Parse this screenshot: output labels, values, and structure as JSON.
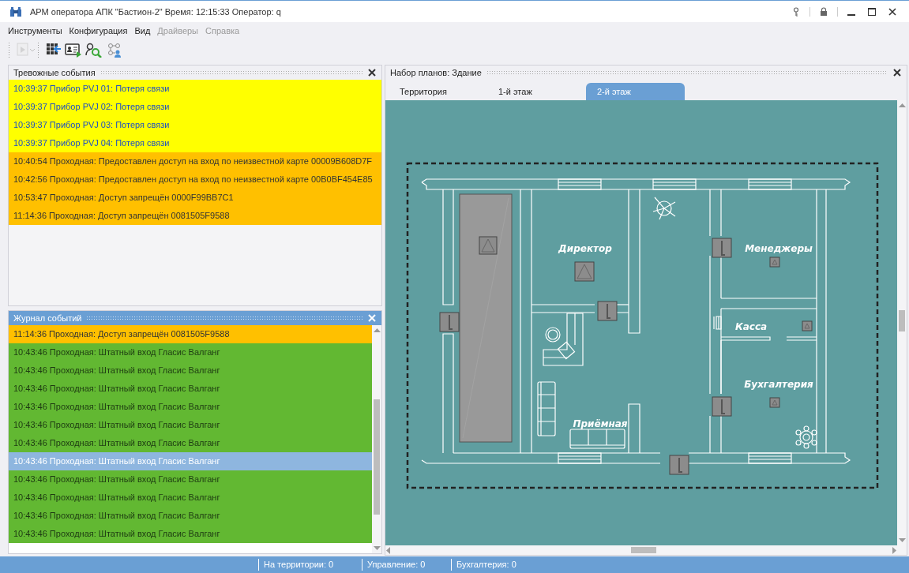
{
  "window": {
    "title": "АРМ оператора АПК \"Бастион-2\" Время: 12:15:33 Оператор: q"
  },
  "menu": [
    {
      "label": "Инструменты",
      "disabled": false
    },
    {
      "label": "Конфигурация",
      "disabled": false
    },
    {
      "label": "Вид",
      "disabled": false
    },
    {
      "label": "Драйверы",
      "disabled": true
    },
    {
      "label": "Справка",
      "disabled": true
    }
  ],
  "toolbar": [
    {
      "kind": "play",
      "disabled": true
    },
    {
      "kind": "grid",
      "disabled": false
    },
    {
      "kind": "card",
      "disabled": false
    },
    {
      "kind": "person-search",
      "disabled": false
    },
    {
      "kind": "network",
      "disabled": false
    }
  ],
  "alarm_panel": {
    "title": "Тревожные события",
    "events": [
      {
        "text": "10:39:37 Прибор PVJ 01: Потеря связи",
        "kind": "device"
      },
      {
        "text": "10:39:37 Прибор PVJ 02: Потеря связи",
        "kind": "device"
      },
      {
        "text": "10:39:37 Прибор PVJ 03: Потеря связи",
        "kind": "device"
      },
      {
        "text": "10:39:37 Прибор PVJ 04: Потеря связи",
        "kind": "device"
      },
      {
        "text": "10:40:54 Проходная: Предоставлен доступ на вход по неизвестной карте 00009B608D7F",
        "kind": "access"
      },
      {
        "text": "10:42:56 Проходная: Предоставлен доступ на вход по неизвестной карте 00B0BF454E85",
        "kind": "access"
      },
      {
        "text": "10:53:47 Проходная: Доступ запрещён 0000F99BB7C1",
        "kind": "access"
      },
      {
        "text": "11:14:36 Проходная: Доступ запрещён 0081505F9588",
        "kind": "access"
      }
    ]
  },
  "journal_panel": {
    "title": "Журнал событий",
    "events": [
      {
        "text": "11:14:36 Проходная: Доступ запрещён 0081505F9588",
        "kind": "denied",
        "selected": false
      },
      {
        "text": "10:43:46 Проходная: Штатный вход Гласис Валганг",
        "kind": "normal",
        "selected": false
      },
      {
        "text": "10:43:46 Проходная: Штатный вход Гласис Валганг",
        "kind": "normal",
        "selected": false
      },
      {
        "text": "10:43:46 Проходная: Штатный вход Гласис Валганг",
        "kind": "normal",
        "selected": false
      },
      {
        "text": "10:43:46 Проходная: Штатный вход Гласис Валганг",
        "kind": "normal",
        "selected": false
      },
      {
        "text": "10:43:46 Проходная: Штатный вход Гласис Валганг",
        "kind": "normal",
        "selected": false
      },
      {
        "text": "10:43:46 Проходная: Штатный вход Гласис Валганг",
        "kind": "normal",
        "selected": false
      },
      {
        "text": "10:43:46 Проходная: Штатный вход Гласис Валганг",
        "kind": "normal",
        "selected": true
      },
      {
        "text": "10:43:46 Проходная: Штатный вход Гласис Валганг",
        "kind": "normal",
        "selected": false
      },
      {
        "text": "10:43:46 Проходная: Штатный вход Гласис Валганг",
        "kind": "normal",
        "selected": false
      },
      {
        "text": "10:43:46 Проходная: Штатный вход Гласис Валганг",
        "kind": "normal",
        "selected": false
      },
      {
        "text": "10:43:46 Проходная: Штатный вход Гласис Валганг",
        "kind": "normal",
        "selected": false
      }
    ]
  },
  "plan_panel": {
    "title": "Набор планов: Здание",
    "tabs": [
      {
        "label": "Территория",
        "selected": false
      },
      {
        "label": "1-й этаж",
        "selected": false
      },
      {
        "label": "2-й этаж",
        "selected": true
      }
    ],
    "rooms": [
      {
        "label": "Директор"
      },
      {
        "label": "Менеджеры"
      },
      {
        "label": "Касса"
      },
      {
        "label": "Бухгалтерия"
      },
      {
        "label": "Приёмная"
      }
    ]
  },
  "status_bar": {
    "sections": [
      "На территории: 0",
      "Управление: 0",
      "Бухгалтерия: 0"
    ]
  }
}
